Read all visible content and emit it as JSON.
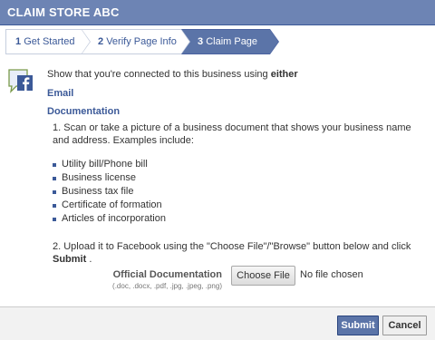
{
  "dialog": {
    "title": "CLAIM STORE ABC"
  },
  "steps": [
    {
      "num": "1",
      "label": "Get Started"
    },
    {
      "num": "2",
      "label": "Verify Page Info"
    },
    {
      "num": "3",
      "label": "Claim Page"
    }
  ],
  "intro": {
    "text": "Show that you're connected to this business using ",
    "emphasis": "either",
    "email_link": "Email",
    "docs_link": "Documentation"
  },
  "instructions": {
    "step1": "1. Scan or take a picture of a business document that shows your business name and address. Examples include:",
    "examples": [
      "Utility bill/Phone bill",
      "Business license",
      "Business tax file",
      "Certificate of formation",
      "Articles of incorporation"
    ],
    "step2_text": "2. Upload it to Facebook using the \"Choose File\"/\"Browse\" button below and click ",
    "step2_bold": "Submit",
    "step2_end": " ."
  },
  "upload": {
    "label": "Official Documentation",
    "formats": "(.doc, .docx, .pdf, .jpg, .jpeg, .png)",
    "choose_label": "Choose File",
    "file_status": "No file chosen"
  },
  "footer": {
    "submit_label": "Submit",
    "cancel_label": "Cancel"
  },
  "colors": {
    "brand": "#3b5998",
    "titlebar": "#6d84b4",
    "active_step": "#5b74a8"
  }
}
